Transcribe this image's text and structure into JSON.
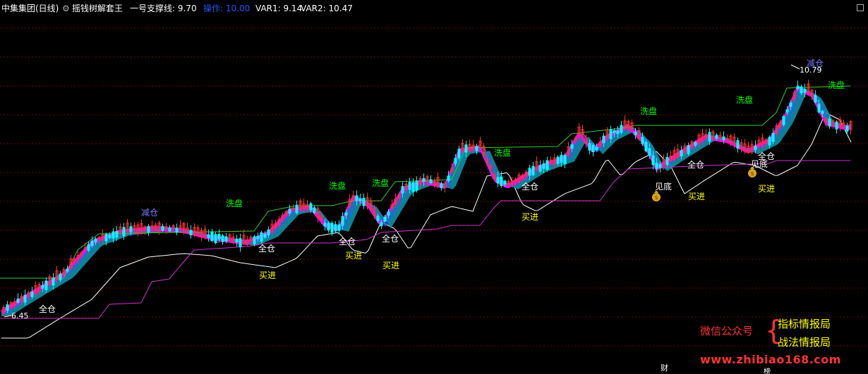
{
  "header": {
    "stock_title": "中集集团(日线)",
    "indicator_name": "摇钱树解套王",
    "support_label": "一号支撑线: 9.70",
    "operation_label": "操作: 10.00",
    "var1_label": "VAR1: 9.14",
    "var2_label": "VAR2: 10.47"
  },
  "price_labels": {
    "high": "10.79",
    "low": "6.45"
  },
  "annotations": [
    {
      "text": "减仓",
      "color": "#7b7bff"
    },
    {
      "text": "减仓",
      "color": "#7b7bff"
    },
    {
      "text": "洗盘",
      "color": "#00ff00"
    },
    {
      "text": "洗盘",
      "color": "#00ff00"
    },
    {
      "text": "洗盘",
      "color": "#00ff00"
    },
    {
      "text": "洗盘",
      "color": "#00ff00"
    },
    {
      "text": "洗盘",
      "color": "#00ff00"
    },
    {
      "text": "洗盘",
      "color": "#00ff00"
    },
    {
      "text": "洗盘",
      "color": "#00ff00"
    },
    {
      "text": "全仓",
      "color": "#ffffff"
    },
    {
      "text": "全仓",
      "color": "#ffffff"
    },
    {
      "text": "全仓",
      "color": "#ffffff"
    },
    {
      "text": "全仓",
      "color": "#ffffff"
    },
    {
      "text": "全仓",
      "color": "#ffffff"
    },
    {
      "text": "全仓",
      "color": "#ffffff"
    },
    {
      "text": "全仓",
      "color": "#ffffff"
    },
    {
      "text": "买进",
      "color": "#ffff00"
    },
    {
      "text": "买进",
      "color": "#ffff00"
    },
    {
      "text": "买进",
      "color": "#ffff00"
    },
    {
      "text": "买进",
      "color": "#ffff00"
    },
    {
      "text": "买进",
      "color": "#ffff00"
    },
    {
      "text": "买进",
      "color": "#ffff00"
    },
    {
      "text": "见底",
      "color": "#ffffff"
    },
    {
      "text": "见底",
      "color": "#ffffff"
    }
  ],
  "footer": {
    "cai_label": "财",
    "fang_label": "榜"
  },
  "watermark": {
    "wechat_label": "微信公众号",
    "line1": "指标情报局",
    "line2": "战法情报局",
    "url": "www.zhibiao168.com"
  },
  "colors": {
    "bg": "#000000",
    "grid": "#7a0000",
    "up": "#ff3333",
    "down": "#00ffff",
    "magenta_band": "#ff00ff",
    "teal_band": "#0f8fa8",
    "blue_line": "#2a5bff",
    "white_line": "#ffffff",
    "support_line": "#cc33cc",
    "resistance_line": "#33cc33"
  }
}
